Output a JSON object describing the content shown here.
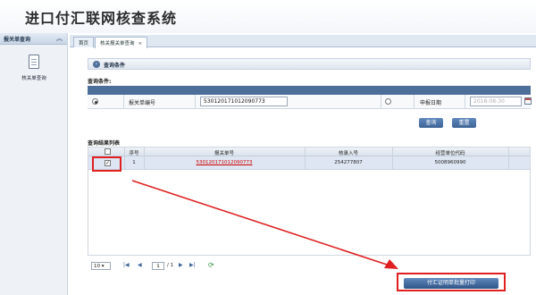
{
  "app": {
    "title": "进口付汇联网核查系统"
  },
  "sidebar": {
    "section_title": "报关单查询",
    "collapse_icon": "chevron-up-icon",
    "items": [
      {
        "label": "核关单查询",
        "icon": "document-icon"
      }
    ]
  },
  "tabs": [
    {
      "label": "首页",
      "active": false
    },
    {
      "label": "核关报关单查询",
      "active": true,
      "close": "×"
    }
  ],
  "query_panel": {
    "section_title": "查询条件",
    "condition_label": "查询条件:",
    "fields": [
      {
        "label": "报关单编号",
        "value": "530120171012090773",
        "selected": true
      },
      {
        "label": "申报日期",
        "placeholder": "2018-08-30",
        "selected": false
      }
    ],
    "buttons": {
      "query": "查询",
      "reset": "重置"
    }
  },
  "results": {
    "title": "查询结果列表",
    "columns": [
      "序号",
      "报关单号",
      "核录入号",
      "经营单位代码"
    ],
    "rows": [
      {
        "checked": true,
        "index": "1",
        "declaration_no": "530120171012090773",
        "entry_no": "254277807",
        "company_code": "5008960990"
      }
    ]
  },
  "pager": {
    "page_size": "10",
    "current_page": "1",
    "total_pages": "/ 1"
  },
  "actions": {
    "batch_print": "付汇证明单批量打印"
  },
  "annotation": {
    "color": "#e02020"
  }
}
